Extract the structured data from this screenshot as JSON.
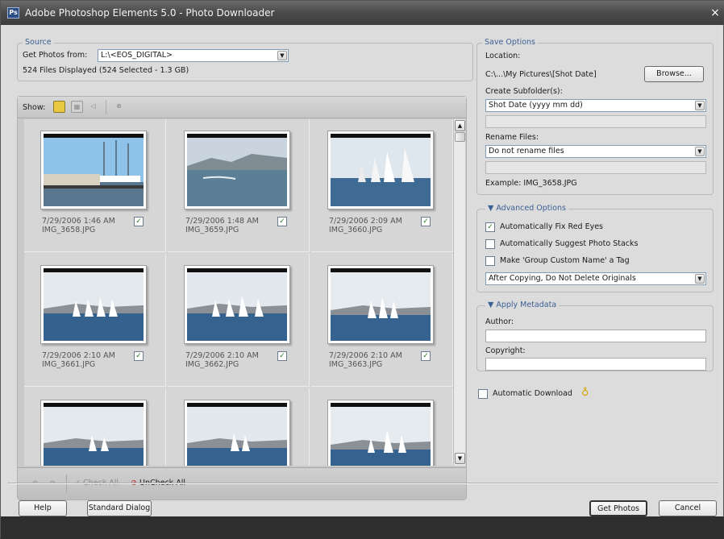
{
  "window": {
    "title": "Adobe Photoshop Elements 5.0 - Photo Downloader",
    "close_glyph": "×",
    "app_icon": "Ps"
  },
  "source": {
    "legend": "Source",
    "get_photos_label": "Get Photos from:",
    "drive_value": "L:\\<EOS_DIGITAL>",
    "status": "524 Files Displayed (524 Selected - 1.3 GB)"
  },
  "show_bar": {
    "label": "Show:"
  },
  "photos": [
    {
      "date": "7/29/2006 1:46 AM",
      "file": "IMG_3658.JPG",
      "checked": true,
      "scene": "harbor"
    },
    {
      "date": "7/29/2006 1:48 AM",
      "file": "IMG_3659.JPG",
      "checked": true,
      "scene": "coast"
    },
    {
      "date": "7/29/2006 2:09 AM",
      "file": "IMG_3660.JPG",
      "checked": true,
      "scene": "sails"
    },
    {
      "date": "7/29/2006 2:10 AM",
      "file": "IMG_3661.JPG",
      "checked": true,
      "scene": "regatta"
    },
    {
      "date": "7/29/2006 2:10 AM",
      "file": "IMG_3662.JPG",
      "checked": true,
      "scene": "regatta"
    },
    {
      "date": "7/29/2006 2:10 AM",
      "file": "IMG_3663.JPG",
      "checked": true,
      "scene": "regatta"
    },
    {
      "date": "",
      "file": "",
      "checked": true,
      "scene": "regatta"
    },
    {
      "date": "",
      "file": "",
      "checked": true,
      "scene": "regatta"
    },
    {
      "date": "",
      "file": "",
      "checked": true,
      "scene": "regatta"
    }
  ],
  "grid_footer": {
    "check_all": "Check All",
    "uncheck_all": "UnCheck All"
  },
  "save_options": {
    "legend": "Save Options",
    "location_label": "Location:",
    "location_value": "C:\\...\\My Pictures\\[Shot Date]",
    "browse_label": "Browse...",
    "subfolder_label": "Create Subfolder(s):",
    "subfolder_value": "Shot Date (yyyy mm dd)",
    "rename_label": "Rename Files:",
    "rename_value": "Do not rename files",
    "example_text": "Example:  IMG_3658.JPG"
  },
  "advanced": {
    "legend": "Advanced Options",
    "fix_red_eyes": {
      "label": "Automatically Fix Red Eyes",
      "checked": true
    },
    "suggest_stacks": {
      "label": "Automatically Suggest Photo Stacks",
      "checked": false
    },
    "make_tag": {
      "label": "Make 'Group Custom Name' a Tag",
      "checked": false
    },
    "after_copy_value": "After Copying, Do Not Delete Originals"
  },
  "metadata": {
    "legend": "Apply Metadata",
    "author_label": "Author:",
    "author_value": "",
    "copyright_label": "Copyright:",
    "copyright_value": ""
  },
  "automatic_download": {
    "label": "Automatic Download",
    "checked": false
  },
  "buttons": {
    "help": "Help",
    "standard_dialog": "Standard Dialog",
    "get_photos": "Get Photos",
    "cancel": "Cancel"
  },
  "colors": {
    "accent": "#3a5f94",
    "check": "#2a7a24"
  }
}
